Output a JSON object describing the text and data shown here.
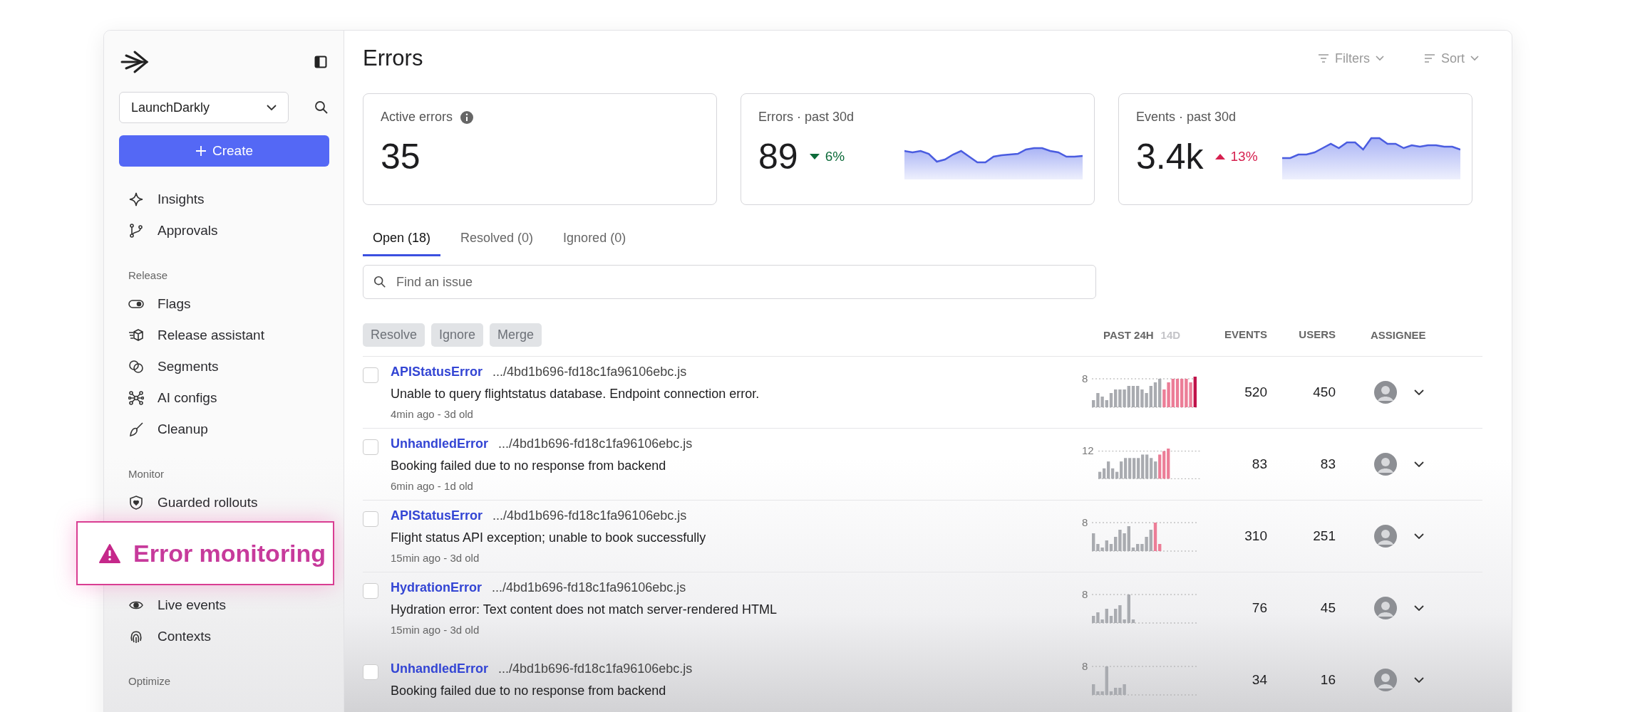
{
  "sidebar": {
    "workspace": "LaunchDarkly",
    "create_button": "Create",
    "sections": [
      {
        "items": [
          {
            "label": "Insights",
            "kind": "link"
          },
          {
            "label": "Approvals",
            "kind": "link"
          }
        ]
      },
      {
        "title": "Release",
        "items": [
          {
            "label": "Flags",
            "kind": "link"
          },
          {
            "label": "Release assistant",
            "kind": "link"
          },
          {
            "label": "Segments",
            "kind": "link"
          },
          {
            "label": "AI configs",
            "kind": "link"
          },
          {
            "label": "Cleanup",
            "kind": "link"
          }
        ]
      },
      {
        "title": "Monitor",
        "items": [
          {
            "label": "Guarded rollouts",
            "kind": "link"
          },
          {
            "label": "Error monitoring",
            "kind": "callout"
          },
          {
            "label": "Live events",
            "kind": "link"
          },
          {
            "label": "Contexts",
            "kind": "link"
          }
        ]
      },
      {
        "title": "Optimize"
      }
    ]
  },
  "header": {
    "title": "Errors",
    "filters": "Filters",
    "sort": "Sort"
  },
  "stats": [
    {
      "kind": "total",
      "label": "Active errors",
      "value": "35"
    },
    {
      "kind": "trend",
      "label": "Errors · past 30d",
      "value": "89",
      "change": "6%",
      "rising": false
    },
    {
      "kind": "trend",
      "label": "Events · past 30d",
      "value": "3.4k",
      "change": "13%",
      "rising": true
    }
  ],
  "tabs": [
    {
      "label": "Open (18)",
      "selected": true
    },
    {
      "label": "Resolved (0)",
      "selected": false
    },
    {
      "label": "Ignored (0)",
      "selected": false
    }
  ],
  "search": {
    "placeholder": "Find an issue"
  },
  "actions": [
    {
      "label": "Resolve",
      "disabled": true
    },
    {
      "label": "Ignore",
      "disabled": true
    },
    {
      "label": "Merge",
      "disabled": true
    }
  ],
  "columns": {
    "range_options": [
      {
        "label": "PAST 24H",
        "selected": true
      },
      {
        "label": "14D",
        "selected": false
      }
    ],
    "events": "EVENTS",
    "users": "USERS",
    "assignee": "ASSIGNEE"
  },
  "rows": [
    {
      "checked": false,
      "error_type": "APIStatusError",
      "file": ".../4bd1b696-fd18c1fa96106ebc.js",
      "message": "Unable to query flightstatus database. Endpoint connection error.",
      "meta": "4min ago - 3d old",
      "scale": "8",
      "events": "520",
      "users": "450"
    },
    {
      "checked": false,
      "error_type": "UnhandledError",
      "file": ".../4bd1b696-fd18c1fa96106ebc.js",
      "message": "Booking failed due to no response from backend",
      "meta": "6min ago - 1d old",
      "scale": "12",
      "events": "83",
      "users": "83"
    },
    {
      "checked": false,
      "error_type": "APIStatusError",
      "file": ".../4bd1b696-fd18c1fa96106ebc.js",
      "message": "Flight status API exception; unable to book successfully",
      "meta": "15min ago - 3d old",
      "scale": "8",
      "events": "310",
      "users": "251"
    },
    {
      "checked": false,
      "error_type": "HydrationError",
      "file": ".../4bd1b696-fd18c1fa96106ebc.js",
      "message": "Hydration error: Text content does not match server-rendered HTML",
      "meta": "15min ago - 3d old",
      "scale": "8",
      "events": "76",
      "users": "45"
    },
    {
      "checked": false,
      "error_type": "UnhandledError",
      "file": ".../4bd1b696-fd18c1fa96106ebc.js",
      "message": "Booking failed due to no response from backend",
      "scale": "8",
      "events": "34",
      "users": "16"
    }
  ]
}
